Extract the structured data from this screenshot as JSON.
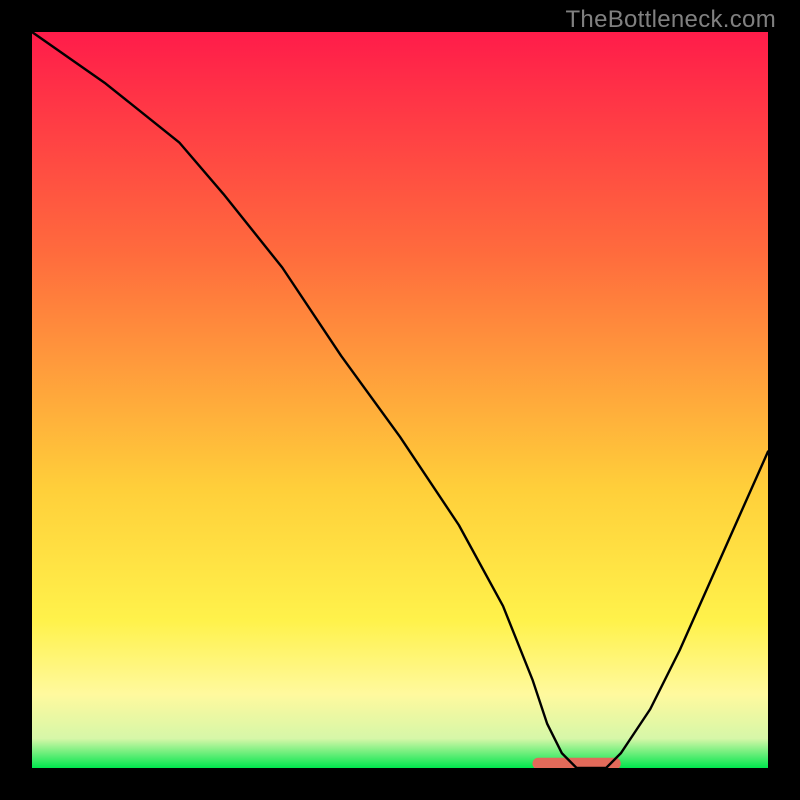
{
  "watermark": "TheBottleneck.com",
  "chart_data": {
    "type": "line",
    "title": "",
    "xlabel": "",
    "ylabel": "",
    "xlim": [
      0,
      100
    ],
    "ylim": [
      0,
      100
    ],
    "grid": false,
    "legend": false,
    "background_gradient": {
      "colors": [
        "#ff1c4a",
        "#ff6b3d",
        "#ffcf3a",
        "#fff24b",
        "#fff99e",
        "#d6f7a8",
        "#00e64d"
      ],
      "stops": [
        0.0,
        0.3,
        0.62,
        0.8,
        0.9,
        0.96,
        1.0
      ]
    },
    "series": [
      {
        "name": "bottleneck-curve",
        "x": [
          0,
          10,
          20,
          26,
          34,
          42,
          50,
          58,
          64,
          68,
          70,
          72,
          74,
          76,
          78,
          80,
          84,
          88,
          92,
          96,
          100
        ],
        "y": [
          100,
          93,
          85,
          78,
          68,
          56,
          45,
          33,
          22,
          12,
          6,
          2,
          0,
          0,
          0,
          2,
          8,
          16,
          25,
          34,
          43
        ],
        "color": "#000000",
        "linewidth": 2.4
      }
    ],
    "markers": [
      {
        "name": "bottom-bar-segment",
        "shape": "pill",
        "x_range": [
          68,
          80
        ],
        "y": 0.6,
        "height_pct": 1.6,
        "color": "#e26a5a"
      }
    ]
  }
}
